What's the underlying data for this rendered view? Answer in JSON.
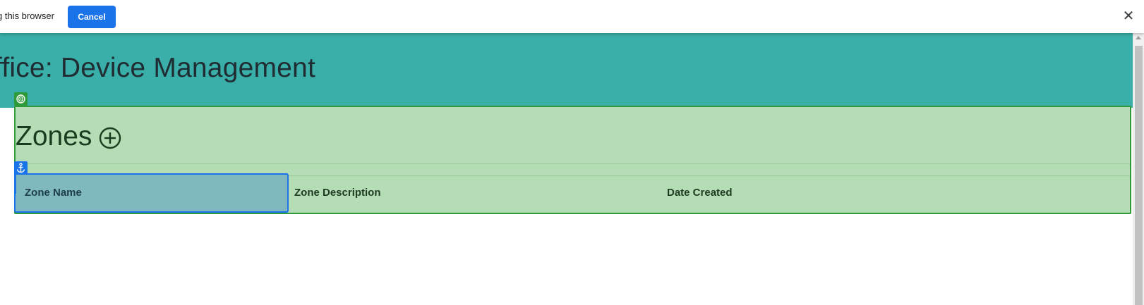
{
  "notification": {
    "text": "g this browser",
    "cancel_label": "Cancel",
    "close_glyph": "✕"
  },
  "header": {
    "title": "ffice: Device Management"
  },
  "zones": {
    "title": "Zones",
    "add_icon": "plus-circle-icon",
    "table": {
      "columns": [
        "Zone Name",
        "Zone Description",
        "Date Created"
      ],
      "rows": []
    }
  },
  "overlays": {
    "region_icon": "target-icon",
    "anchor_icon": "anchor-icon"
  },
  "colors": {
    "accent": "#1a73e8",
    "header_band": "#3aaea8",
    "region_fill": "#b4ddb5",
    "region_border": "#2e9a3a"
  }
}
